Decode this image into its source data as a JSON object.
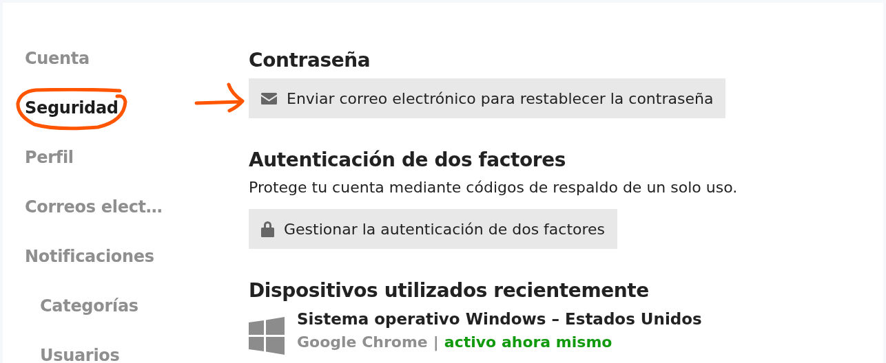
{
  "sidebar": {
    "items": [
      {
        "label": "Cuenta",
        "selected": false
      },
      {
        "label": "Seguridad",
        "selected": true
      },
      {
        "label": "Perfil",
        "selected": false
      },
      {
        "label": "Correos elect…",
        "selected": false
      },
      {
        "label": "Notificaciones",
        "selected": false,
        "children": [
          {
            "label": "Categorías",
            "selected": false
          },
          {
            "label": "Usuarios",
            "selected": false
          }
        ]
      }
    ]
  },
  "sections": [
    {
      "title": "Contraseña",
      "buttons": [
        {
          "label": "Enviar correo electrónico para restablecer la contraseña"
        }
      ]
    },
    {
      "title": "Autenticación de dos factores",
      "description": "Protege tu cuenta mediante códigos de respaldo de un solo uso.",
      "buttons": [
        {
          "label": "Gestionar la autenticación de dos factores"
        }
      ]
    },
    {
      "title": "Dispositivos utilizados recientemente",
      "devices": [
        {
          "name": "Sistema operativo Windows – Estados Unidos",
          "browser": "Google Chrome",
          "separator": "|",
          "status": "activo ahora mismo",
          "active": true
        }
      ]
    }
  ]
}
